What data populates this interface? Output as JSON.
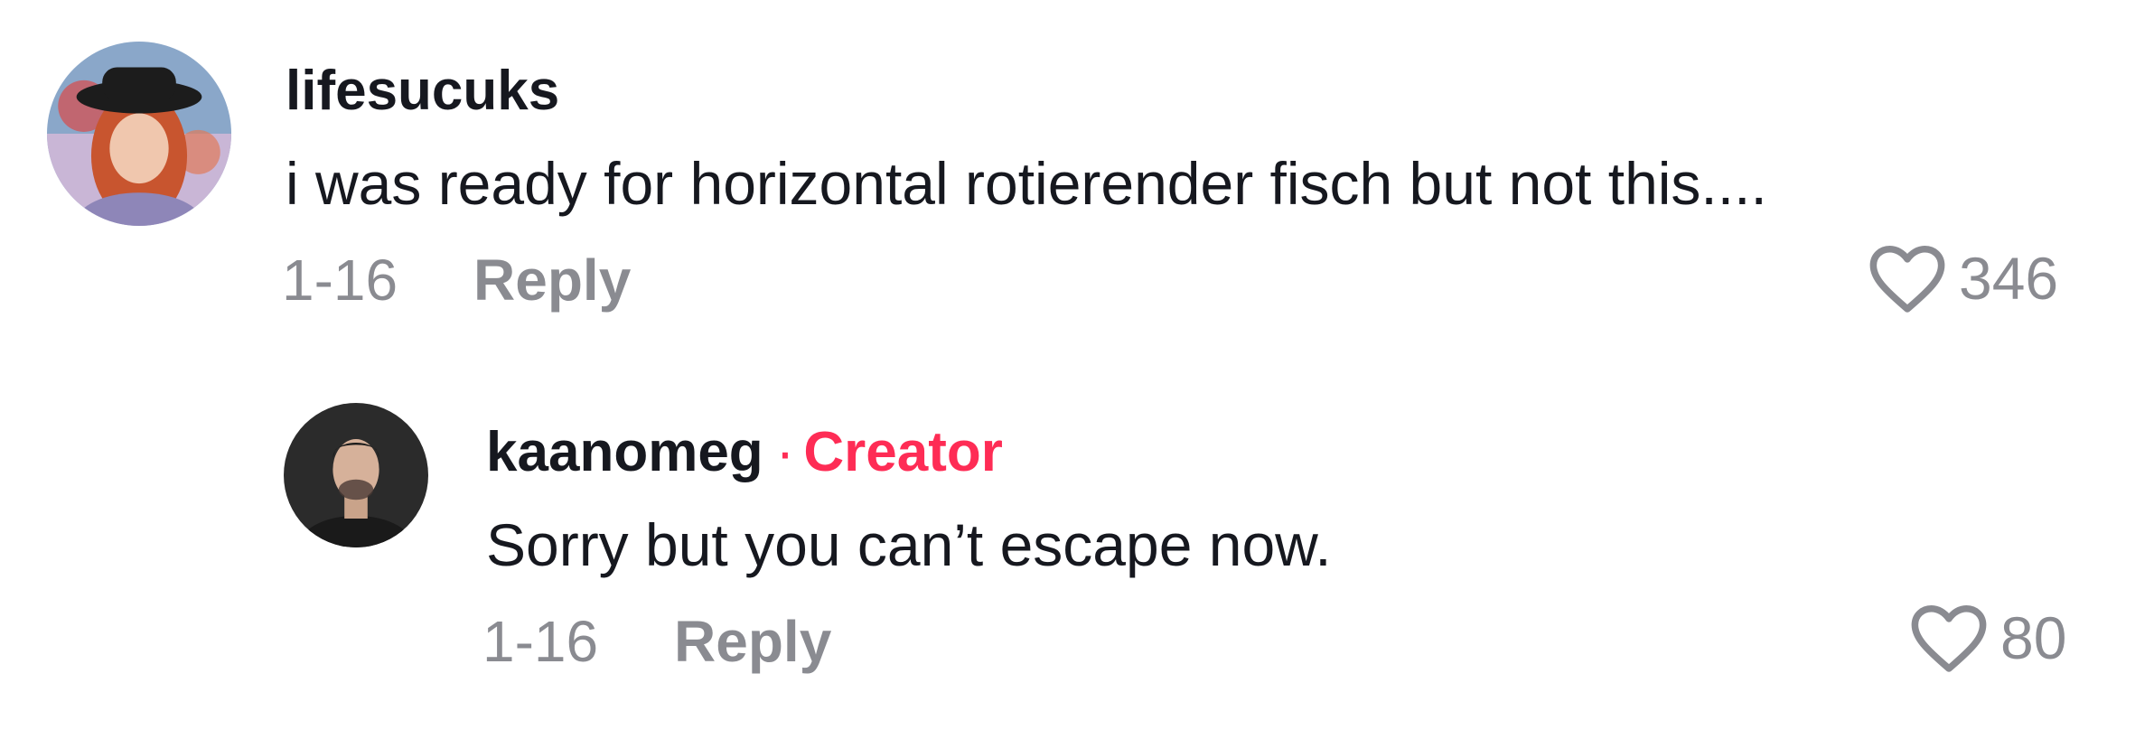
{
  "comments": [
    {
      "username": "lifesucuks",
      "text": "i was ready for horizontal rotierender fisch but not this....",
      "date": "1-16",
      "reply_label": "Reply",
      "likes": "346",
      "avatar_icon": "user-avatar-icon"
    },
    {
      "username": "kaanomeg",
      "separator": "·",
      "badge": "Creator",
      "text": "Sorry but you can’t escape now.",
      "date": "1-16",
      "reply_label": "Reply",
      "likes": "80",
      "avatar_icon": "user-avatar-icon"
    }
  ],
  "colors": {
    "text": "#16181f",
    "muted": "#8a8b91",
    "accent": "#fe2c55"
  },
  "icons": {
    "like": "heart-outline-icon"
  }
}
